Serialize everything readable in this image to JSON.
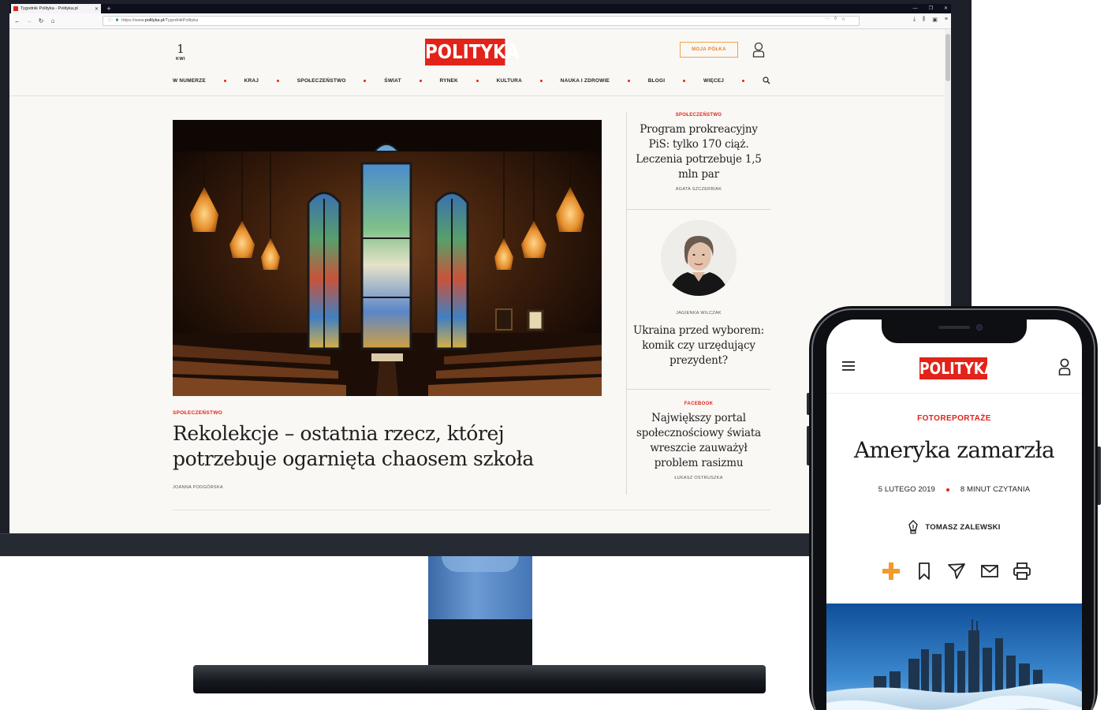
{
  "browser": {
    "tab_title": "Tygodnik Polityka - Polityka.pl",
    "tab_close": "✕",
    "new_tab": "+",
    "url_prefix": "https://www.",
    "url_domain": "polityka.pl",
    "url_path": "/TygodnikPolityka"
  },
  "desktop": {
    "date": {
      "day": "1",
      "month": "KWI"
    },
    "logo": "POLITYKA",
    "moja_polka": "MOJA PÓŁKA",
    "nav": [
      "W NUMERZE",
      "KRAJ",
      "SPOŁECZEŃSTWO",
      "ŚWIAT",
      "RYNEK",
      "KULTURA",
      "NAUKA I ZDROWIE",
      "BLOGI",
      "WIĘCEJ"
    ],
    "lead": {
      "kicker": "SPOŁECZEŃSTWO",
      "title": "Rekolekcje – ostatnia rzecz, której potrzebuje ogarnięta chaosem szkoła",
      "author": "JOANNA PODGÓRSKA"
    },
    "side": [
      {
        "kicker": "SPOŁECZEŃSTWO",
        "title": "Program prokreacyjny PiS: tylko 170 ciąż. Leczenia potrzebuje 1,5 mln par",
        "author": "AGATA SZCZERBIAK"
      },
      {
        "author": "JAGIENKA WILCZAK",
        "title": "Ukraina przed wyborem: komik czy urzędujący prezydent?"
      },
      {
        "kicker": "FACEBOOK",
        "title": "Największy portal społecznościowy świata wreszcie zauważył problem rasizmu",
        "author": "ŁUKASZ OSTRUSZKA"
      }
    ]
  },
  "mobile": {
    "logo": "POLITYKA",
    "kicker": "FOTOREPORTAŻE",
    "title": "Ameryka zamarzła",
    "date": "5 LUTEGO 2019",
    "read_time": "8 MINUT CZYTANIA",
    "author": "TOMASZ ZALEWSKI"
  },
  "colors": {
    "brand_red": "#e2231a",
    "accent_orange": "#f0a24a",
    "page_bg": "#faf8f4"
  },
  "icons": {
    "mobile_actions": [
      "plus-icon",
      "bookmark-icon",
      "send-icon",
      "mail-icon",
      "print-icon"
    ]
  }
}
